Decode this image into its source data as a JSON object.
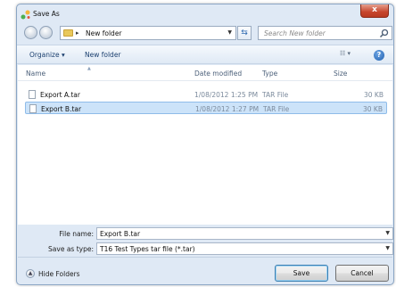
{
  "window": {
    "title": "Save As",
    "close_label": "x"
  },
  "address_bar": {
    "separator": "▸",
    "current_folder": "New folder"
  },
  "search": {
    "placeholder": "Search New folder"
  },
  "toolbar": {
    "organize_label": "Organize ▾",
    "new_folder_label": "New folder"
  },
  "columns": {
    "name": "Name",
    "date_modified": "Date modified",
    "type": "Type",
    "size": "Size"
  },
  "files": [
    {
      "name": "Export A.tar",
      "date": "1/08/2012 1:25 PM",
      "type": "TAR File",
      "size": "30 KB"
    },
    {
      "name": "Export B.tar",
      "date": "1/08/2012 1:27 PM",
      "type": "TAR File",
      "size": "30 KB",
      "selected": true
    }
  ],
  "form": {
    "file_name_label": "File name:",
    "file_name_value": "Export B.tar",
    "save_as_type_label": "Save as type:",
    "save_as_type_value": "T16 Test Types tar file (*.tar)"
  },
  "footer": {
    "hide_folders_label": "Hide Folders",
    "save_label": "Save",
    "cancel_label": "Cancel"
  },
  "colors": {
    "accent": "#3c7fb1",
    "selection": "#cce3f9",
    "close": "#c6452c",
    "chrome": "#dfe9f5"
  }
}
